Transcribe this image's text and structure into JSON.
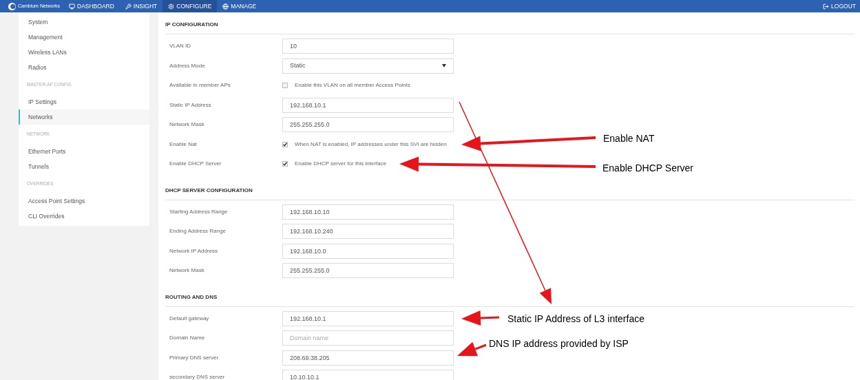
{
  "nav": {
    "brand": "Cambium Networks",
    "tabs": [
      {
        "label": "DASHBOARD",
        "selected": false
      },
      {
        "label": "INSIGHT",
        "selected": false
      },
      {
        "label": "CONFIGURE",
        "selected": true
      },
      {
        "label": "MANAGE",
        "selected": false
      }
    ],
    "logout": "LOGOUT"
  },
  "sidebar": {
    "items": [
      {
        "kind": "link",
        "label": "System",
        "selected": false
      },
      {
        "kind": "link",
        "label": "Management",
        "selected": false
      },
      {
        "kind": "link",
        "label": "Wireless LANs",
        "selected": false
      },
      {
        "kind": "link",
        "label": "Radios",
        "selected": false
      },
      {
        "kind": "heading",
        "label": "MASTER-AP CONFIG"
      },
      {
        "kind": "link",
        "label": "IP Settings",
        "selected": false
      },
      {
        "kind": "link",
        "label": "Networks",
        "selected": true
      },
      {
        "kind": "heading",
        "label": "NETWORK"
      },
      {
        "kind": "link",
        "label": "Ethernet Ports",
        "selected": false
      },
      {
        "kind": "link",
        "label": "Tunnels",
        "selected": false
      },
      {
        "kind": "heading",
        "label": "OVERRIDES"
      },
      {
        "kind": "link",
        "label": "Access Point Settings",
        "selected": false
      },
      {
        "kind": "link",
        "label": "CLI Overrides",
        "selected": false
      }
    ]
  },
  "sections": [
    {
      "title": "IP CONFIGURATION",
      "rows": [
        {
          "kind": "input",
          "label": "VLAN ID",
          "value": "10"
        },
        {
          "kind": "select",
          "label": "Address Mode",
          "value": "Static"
        },
        {
          "kind": "checkbox",
          "label": "Available in member APs",
          "checked": false,
          "text": "Enable this VLAN on all member Access Points"
        },
        {
          "kind": "input",
          "label": "Static IP Address",
          "value": "192.168.10.1"
        },
        {
          "kind": "input",
          "label": "Network Mask",
          "value": "255.255.255.0"
        },
        {
          "kind": "checkbox",
          "label": "Enable Nat",
          "checked": true,
          "text": "When NAT is enabled, IP addresses under this SVI are hidden"
        },
        {
          "kind": "checkbox",
          "label": "Enable DHCP Server",
          "checked": true,
          "text": "Enable DHCP server for this interface"
        }
      ]
    },
    {
      "title": "DHCP SERVER CONFIGURATION",
      "rows": [
        {
          "kind": "input",
          "label": "Starting Address Range",
          "value": "192.168.10.10"
        },
        {
          "kind": "input",
          "label": "Ending Address Range",
          "value": "192.168.10.240"
        },
        {
          "kind": "input",
          "label": "Network IP Address",
          "value": "192.168.10.0"
        },
        {
          "kind": "input",
          "label": "Network Mask",
          "value": "255.255.255.0"
        }
      ]
    },
    {
      "title": "ROUTING AND DNS",
      "rows": [
        {
          "kind": "input",
          "label": "Default gateway",
          "value": "192.168.10.1"
        },
        {
          "kind": "input",
          "label": "Domain Name",
          "placeholder": "Domain name"
        },
        {
          "kind": "input",
          "label": "Primary DNS server",
          "value": "208.69.38.205"
        },
        {
          "kind": "input",
          "label": "secondary DNS server",
          "value": "10.10.10.1"
        }
      ]
    }
  ],
  "annotations": [
    {
      "text": "Enable NAT"
    },
    {
      "text": "Enable DHCP Server"
    },
    {
      "text": "Static IP Address of L3 interface"
    },
    {
      "text": "DNS IP address provided by ISP"
    }
  ]
}
